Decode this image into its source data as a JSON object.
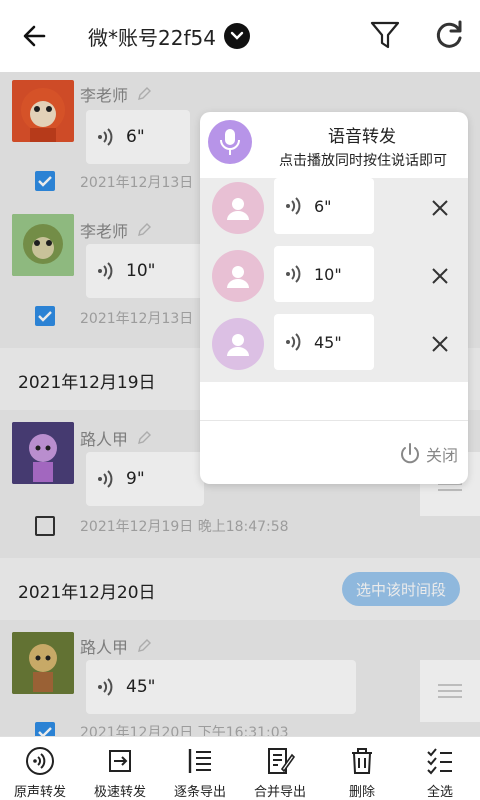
{
  "header": {
    "account_label": "微*账号22f54"
  },
  "messages_top": [
    {
      "sender": "李老师",
      "duration": "6\"",
      "time": "2021年12月13日",
      "checked": true
    },
    {
      "sender": "李老师",
      "duration": "10\"",
      "time": "2021年12月13日",
      "checked": true
    }
  ],
  "date_groups": [
    {
      "date": "2021年12月19日"
    },
    {
      "date": "2021年12月20日",
      "select_label": "选中该时间段"
    }
  ],
  "messages_bottom": [
    {
      "sender": "路人甲",
      "duration": "9\"",
      "time": "2021年12月19日 晚上18:47:58",
      "checked": false
    },
    {
      "sender": "路人甲",
      "duration": "45\"",
      "time": "2021年12月20日 下午16:31:03",
      "checked": true
    }
  ],
  "popup": {
    "title": "语音转发",
    "subtitle": "点击播放同时按住说话即可",
    "items": [
      {
        "duration": "6\""
      },
      {
        "duration": "10\""
      },
      {
        "duration": "45\""
      }
    ],
    "close_label": "关闭"
  },
  "toolbar": [
    {
      "label": "原声转发",
      "icon": "voice-forward-icon"
    },
    {
      "label": "极速转发",
      "icon": "fast-forward-icon"
    },
    {
      "label": "逐条导出",
      "icon": "list-export-icon"
    },
    {
      "label": "合并导出",
      "icon": "merge-export-icon"
    },
    {
      "label": "删除",
      "icon": "trash-icon"
    },
    {
      "label": "全选",
      "icon": "select-all-icon"
    }
  ],
  "colors": {
    "accent": "#2f8ee6",
    "mic_purple": "#b794e8",
    "select_button": "#9cc8f0"
  }
}
